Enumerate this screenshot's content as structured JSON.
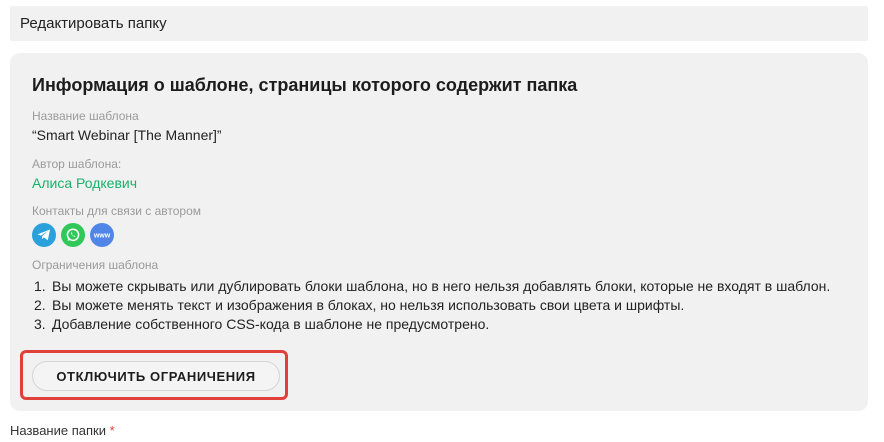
{
  "header": {
    "title": "Редактировать папку"
  },
  "template_info": {
    "title": "Информация о шаблоне, страницы которого содержит папка",
    "template_name_label": "Название шаблона",
    "template_name_value": "“Smart Webinar [The Manner]”",
    "author_label": "Автор шаблона:",
    "author_value": "Алиса Родкевич",
    "contacts_label": "Контакты для связи с автором",
    "contacts": [
      {
        "icon": "telegram-icon",
        "color": "#2aa1da"
      },
      {
        "icon": "whatsapp-icon",
        "color": "#32c759"
      },
      {
        "icon": "website-icon",
        "color": "#4f86e8",
        "text": "www"
      }
    ],
    "restrictions_label": "Ограничения шаблона",
    "restrictions": [
      "Вы можете скрывать или дублировать блоки шаблона, но в него нельзя добавлять блоки, которые не входят в шаблон.",
      "Вы можете менять текст и изображения в блоках, но нельзя использовать свои цвета и шрифты.",
      "Добавление собственного CSS-кода в шаблоне не предусмотрено."
    ],
    "disable_button_label": "ОТКЛЮЧИТЬ ОГРАНИЧЕНИЯ"
  },
  "folder_form": {
    "folder_name_label": "Название папки",
    "required_mark": "*"
  },
  "colors": {
    "accent_green": "#17b26a",
    "highlight_red": "#e0403a",
    "card_background": "#f1f1f1"
  }
}
